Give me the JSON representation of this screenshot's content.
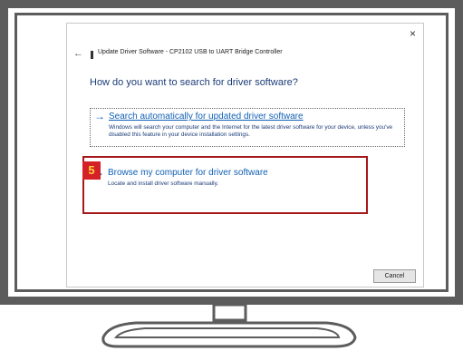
{
  "dialog": {
    "title": "Update Driver Software - CP2102 USB to UART Bridge Controller",
    "heading": "How do you want to search for driver software?",
    "close_glyph": "×",
    "back_glyph": "←",
    "options": [
      {
        "arrow": "→",
        "title": "Search automatically for updated driver software",
        "description": "Windows will search your computer and the Internet for the latest driver software for your device, unless you've disabled this feature in your device installation settings."
      },
      {
        "arrow": "→",
        "title": "Browse my computer for driver software",
        "description": "Locate and install driver software manually."
      }
    ],
    "cancel_label": "Cancel"
  },
  "annotation": {
    "step_number": "5",
    "highlight_color": "#a4191c",
    "badge_color": "#d42027",
    "badge_text_color": "#ffd43a"
  },
  "colors": {
    "monitor_frame": "#5c5c5c",
    "link_blue": "#1160b4",
    "heading_blue": "#1c3c78"
  }
}
